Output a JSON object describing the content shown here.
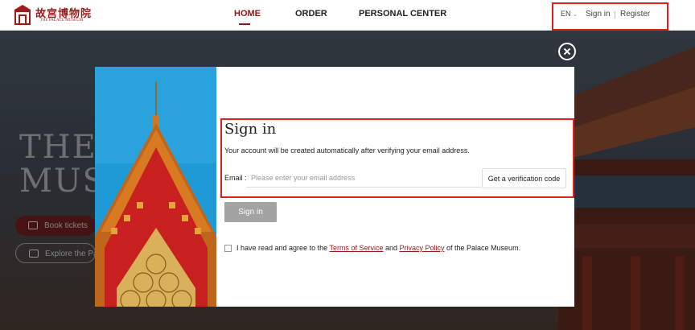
{
  "header": {
    "logo_cn": "故宫博物院",
    "logo_en": "THE PALACE MUSEUM",
    "nav": [
      "HOME",
      "ORDER",
      "PERSONAL CENTER"
    ],
    "language": "EN",
    "sign_in": "Sign in",
    "register": "Register"
  },
  "hero": {
    "title_line1": "THE P",
    "title_line2": "MUSE",
    "book_tickets": "Book tickets",
    "explore": "Explore the Pa"
  },
  "modal": {
    "title": "Sign in",
    "description": "Your account will be created automatically after verifying your email address.",
    "email_label": "Email :",
    "email_placeholder": "Please enter your email address",
    "email_value": "",
    "verify_button": "Get a verification code",
    "submit_button": "Sign in",
    "agree_prefix": "I have read and agree to the ",
    "terms_link": "Terms of Service",
    "agree_and": " and ",
    "privacy_link": "Privacy Policy",
    "agree_suffix": " of the Palace Museum.",
    "agree_checked": false
  },
  "colors": {
    "brand_red": "#9e1b1b",
    "highlight_red": "#e02020",
    "disabled_button": "#a3a3a3"
  }
}
